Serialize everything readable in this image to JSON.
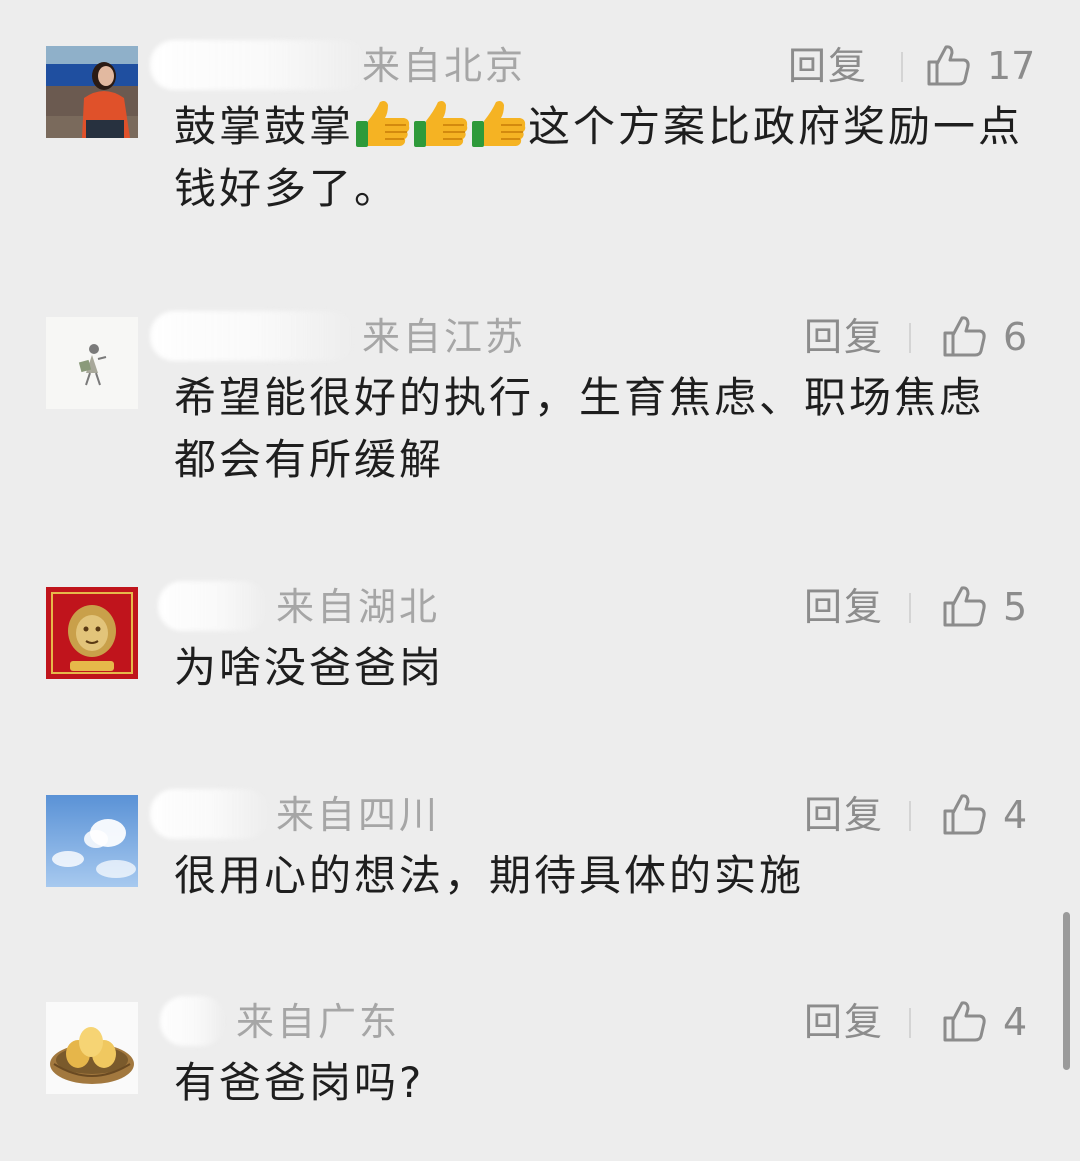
{
  "comments": [
    {
      "location": "来自北京",
      "reply_label": "回复",
      "likes": "17",
      "text_before": "鼓掌鼓掌",
      "emoji": [
        "thumbs-up-emoji",
        "thumbs-up-emoji",
        "thumbs-up-emoji"
      ],
      "text_after": "这个方案比政府奖励一点钱好多了。"
    },
    {
      "location": "来自江苏",
      "reply_label": "回复",
      "likes": "6",
      "text": "希望能很好的执行，生育焦虑、职场焦虑都会有所缓解"
    },
    {
      "location": "来自湖北",
      "reply_label": "回复",
      "likes": "5",
      "text": "为啥没爸爸岗"
    },
    {
      "location": "来自四川",
      "reply_label": "回复",
      "likes": "4",
      "text": "很用心的想法，期待具体的实施"
    },
    {
      "location": "来自广东",
      "reply_label": "回复",
      "likes": "4",
      "text": "有爸爸岗吗?"
    }
  ],
  "icons": {
    "like": "thumbs-up-outline-icon",
    "emoji": "thumbs-up-emoji"
  },
  "colors": {
    "background": "#ededed",
    "text": "#1e1e1e",
    "meta": "#a6a6a6",
    "action": "#8c8c8c"
  }
}
